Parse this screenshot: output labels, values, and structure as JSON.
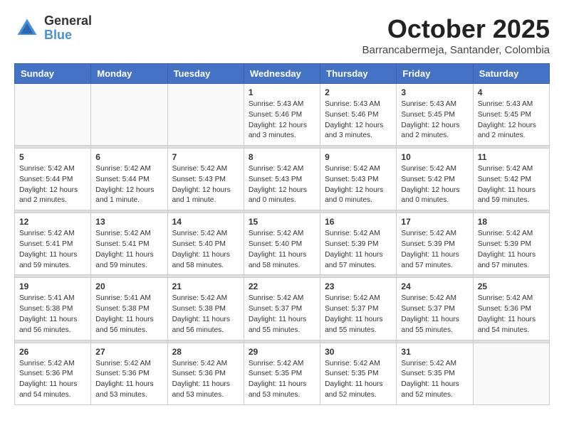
{
  "logo": {
    "general": "General",
    "blue": "Blue"
  },
  "header": {
    "month": "October 2025",
    "location": "Barrancabermeja, Santander, Colombia"
  },
  "weekdays": [
    "Sunday",
    "Monday",
    "Tuesday",
    "Wednesday",
    "Thursday",
    "Friday",
    "Saturday"
  ],
  "weeks": [
    [
      {
        "day": "",
        "info": ""
      },
      {
        "day": "",
        "info": ""
      },
      {
        "day": "",
        "info": ""
      },
      {
        "day": "1",
        "info": "Sunrise: 5:43 AM\nSunset: 5:46 PM\nDaylight: 12 hours\nand 3 minutes."
      },
      {
        "day": "2",
        "info": "Sunrise: 5:43 AM\nSunset: 5:46 PM\nDaylight: 12 hours\nand 3 minutes."
      },
      {
        "day": "3",
        "info": "Sunrise: 5:43 AM\nSunset: 5:45 PM\nDaylight: 12 hours\nand 2 minutes."
      },
      {
        "day": "4",
        "info": "Sunrise: 5:43 AM\nSunset: 5:45 PM\nDaylight: 12 hours\nand 2 minutes."
      }
    ],
    [
      {
        "day": "5",
        "info": "Sunrise: 5:42 AM\nSunset: 5:44 PM\nDaylight: 12 hours\nand 2 minutes."
      },
      {
        "day": "6",
        "info": "Sunrise: 5:42 AM\nSunset: 5:44 PM\nDaylight: 12 hours\nand 1 minute."
      },
      {
        "day": "7",
        "info": "Sunrise: 5:42 AM\nSunset: 5:43 PM\nDaylight: 12 hours\nand 1 minute."
      },
      {
        "day": "8",
        "info": "Sunrise: 5:42 AM\nSunset: 5:43 PM\nDaylight: 12 hours\nand 0 minutes."
      },
      {
        "day": "9",
        "info": "Sunrise: 5:42 AM\nSunset: 5:43 PM\nDaylight: 12 hours\nand 0 minutes."
      },
      {
        "day": "10",
        "info": "Sunrise: 5:42 AM\nSunset: 5:42 PM\nDaylight: 12 hours\nand 0 minutes."
      },
      {
        "day": "11",
        "info": "Sunrise: 5:42 AM\nSunset: 5:42 PM\nDaylight: 11 hours\nand 59 minutes."
      }
    ],
    [
      {
        "day": "12",
        "info": "Sunrise: 5:42 AM\nSunset: 5:41 PM\nDaylight: 11 hours\nand 59 minutes."
      },
      {
        "day": "13",
        "info": "Sunrise: 5:42 AM\nSunset: 5:41 PM\nDaylight: 11 hours\nand 59 minutes."
      },
      {
        "day": "14",
        "info": "Sunrise: 5:42 AM\nSunset: 5:40 PM\nDaylight: 11 hours\nand 58 minutes."
      },
      {
        "day": "15",
        "info": "Sunrise: 5:42 AM\nSunset: 5:40 PM\nDaylight: 11 hours\nand 58 minutes."
      },
      {
        "day": "16",
        "info": "Sunrise: 5:42 AM\nSunset: 5:39 PM\nDaylight: 11 hours\nand 57 minutes."
      },
      {
        "day": "17",
        "info": "Sunrise: 5:42 AM\nSunset: 5:39 PM\nDaylight: 11 hours\nand 57 minutes."
      },
      {
        "day": "18",
        "info": "Sunrise: 5:42 AM\nSunset: 5:39 PM\nDaylight: 11 hours\nand 57 minutes."
      }
    ],
    [
      {
        "day": "19",
        "info": "Sunrise: 5:41 AM\nSunset: 5:38 PM\nDaylight: 11 hours\nand 56 minutes."
      },
      {
        "day": "20",
        "info": "Sunrise: 5:41 AM\nSunset: 5:38 PM\nDaylight: 11 hours\nand 56 minutes."
      },
      {
        "day": "21",
        "info": "Sunrise: 5:42 AM\nSunset: 5:38 PM\nDaylight: 11 hours\nand 56 minutes."
      },
      {
        "day": "22",
        "info": "Sunrise: 5:42 AM\nSunset: 5:37 PM\nDaylight: 11 hours\nand 55 minutes."
      },
      {
        "day": "23",
        "info": "Sunrise: 5:42 AM\nSunset: 5:37 PM\nDaylight: 11 hours\nand 55 minutes."
      },
      {
        "day": "24",
        "info": "Sunrise: 5:42 AM\nSunset: 5:37 PM\nDaylight: 11 hours\nand 55 minutes."
      },
      {
        "day": "25",
        "info": "Sunrise: 5:42 AM\nSunset: 5:36 PM\nDaylight: 11 hours\nand 54 minutes."
      }
    ],
    [
      {
        "day": "26",
        "info": "Sunrise: 5:42 AM\nSunset: 5:36 PM\nDaylight: 11 hours\nand 54 minutes."
      },
      {
        "day": "27",
        "info": "Sunrise: 5:42 AM\nSunset: 5:36 PM\nDaylight: 11 hours\nand 53 minutes."
      },
      {
        "day": "28",
        "info": "Sunrise: 5:42 AM\nSunset: 5:36 PM\nDaylight: 11 hours\nand 53 minutes."
      },
      {
        "day": "29",
        "info": "Sunrise: 5:42 AM\nSunset: 5:35 PM\nDaylight: 11 hours\nand 53 minutes."
      },
      {
        "day": "30",
        "info": "Sunrise: 5:42 AM\nSunset: 5:35 PM\nDaylight: 11 hours\nand 52 minutes."
      },
      {
        "day": "31",
        "info": "Sunrise: 5:42 AM\nSunset: 5:35 PM\nDaylight: 11 hours\nand 52 minutes."
      },
      {
        "day": "",
        "info": ""
      }
    ]
  ]
}
